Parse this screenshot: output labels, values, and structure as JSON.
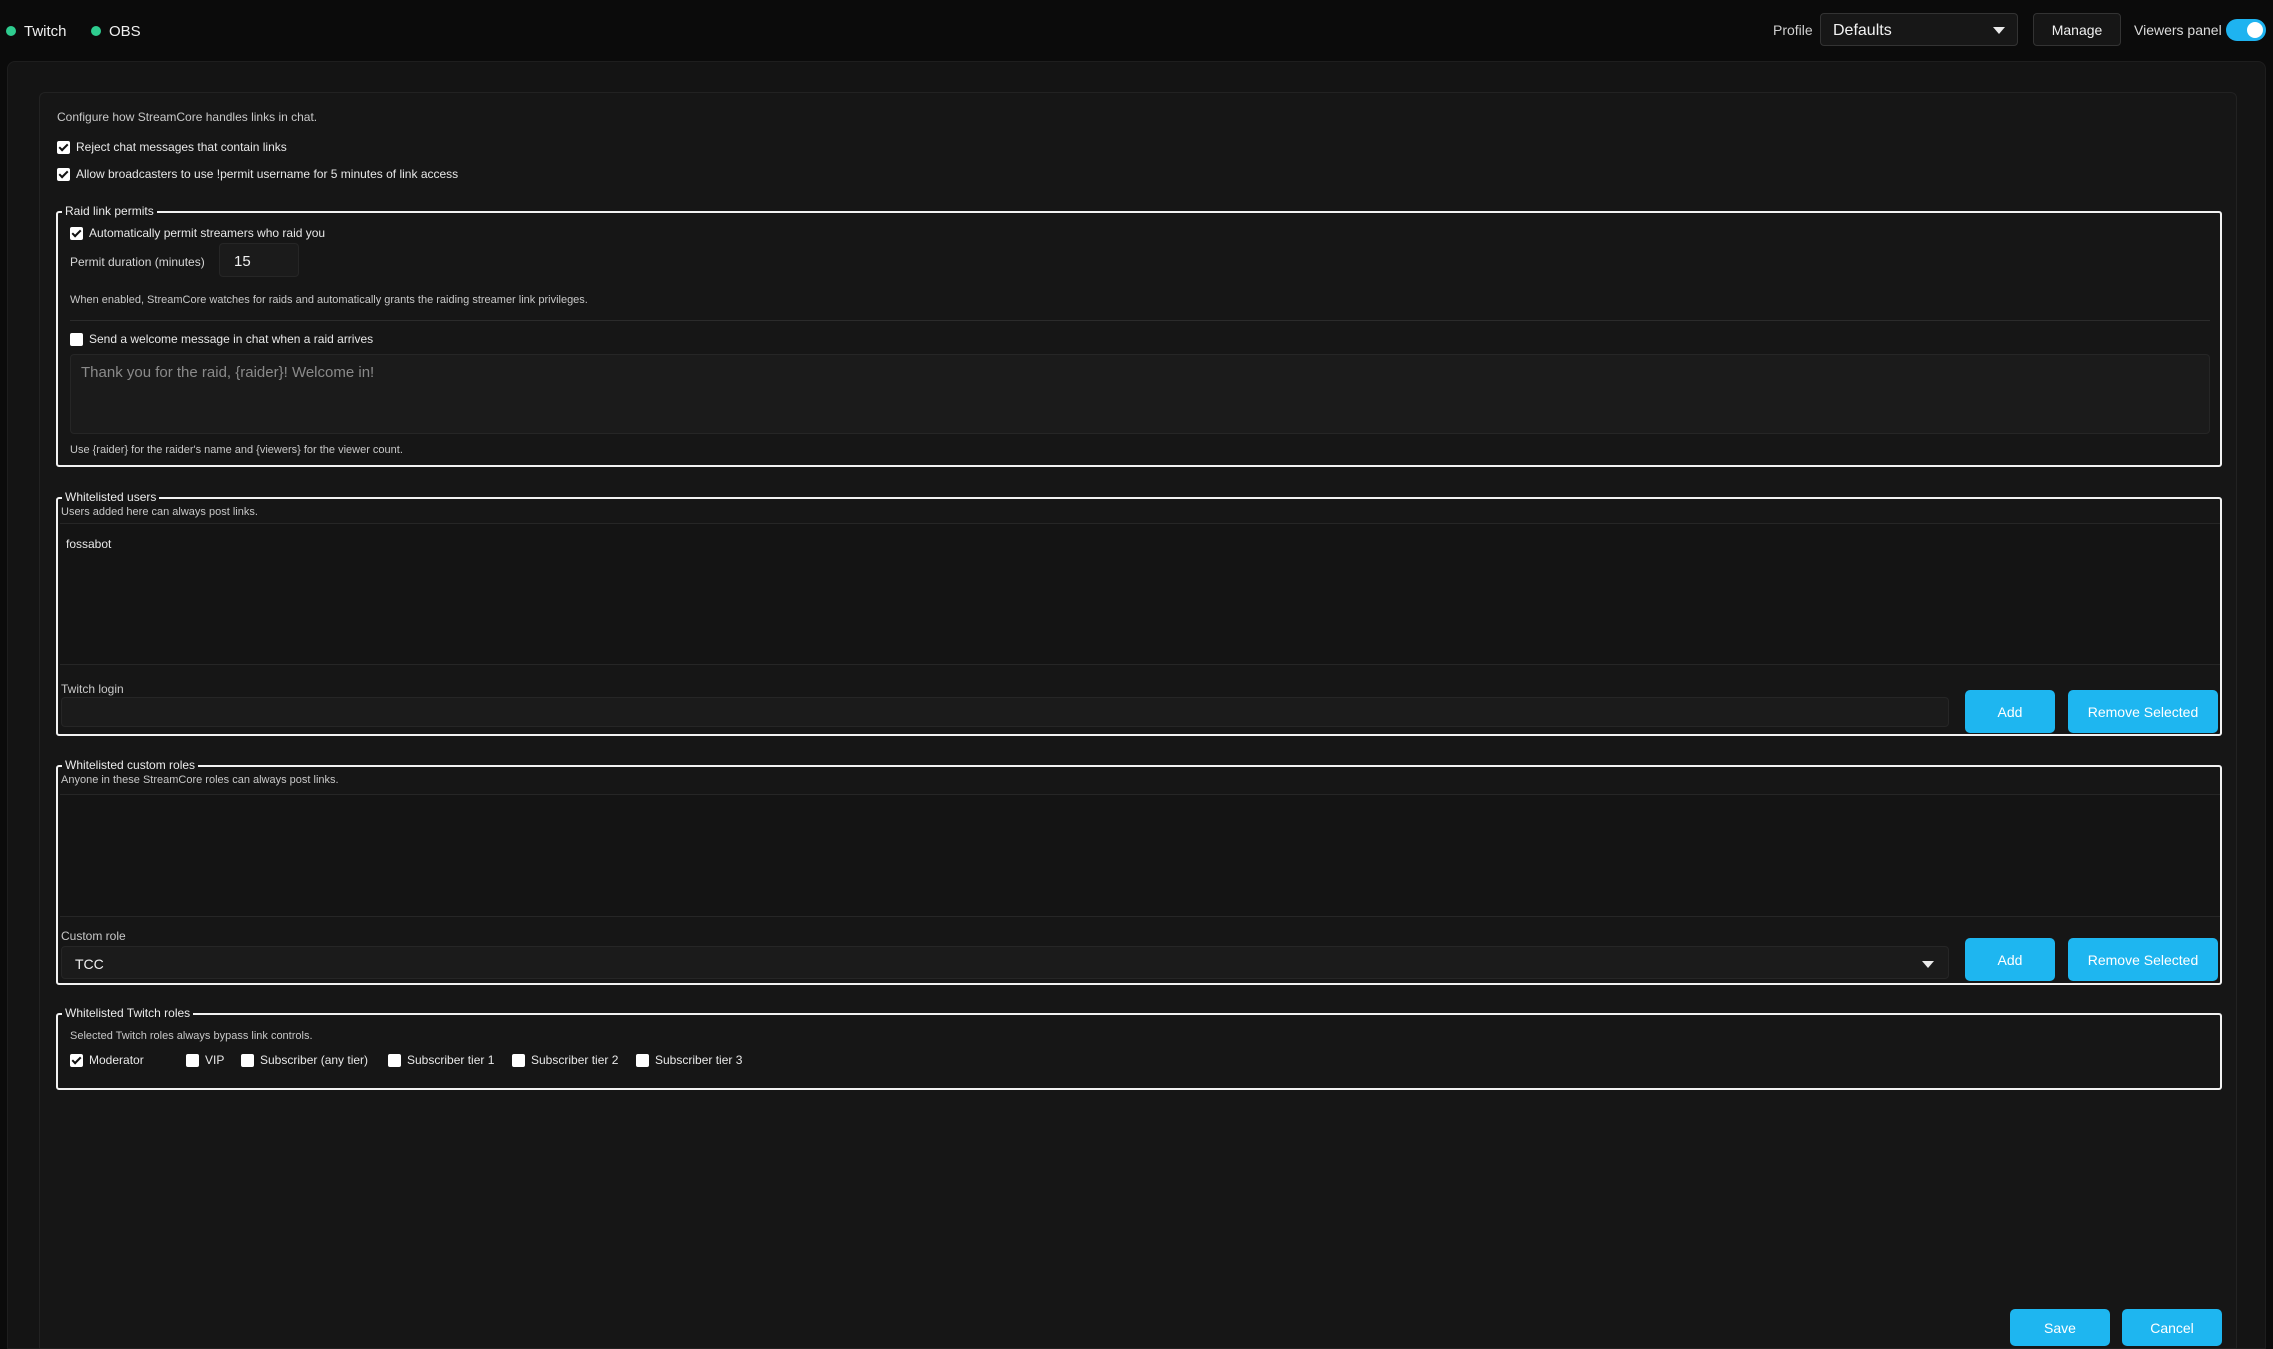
{
  "topbar": {
    "connections": [
      {
        "label": "Twitch",
        "status_color": "#2ecc8f"
      },
      {
        "label": "OBS",
        "status_color": "#2ecc8f"
      }
    ],
    "profile_label": "Profile",
    "profile_value": "Defaults",
    "manage_label": "Manage",
    "viewers_panel_label": "Viewers panel",
    "viewers_panel_on": true
  },
  "links": {
    "intro": "Configure how StreamCore handles links in chat.",
    "reject_links": {
      "label": "Reject chat messages that contain links",
      "checked": true
    },
    "allow_permit": {
      "label": "Allow broadcasters to use !permit username for 5 minutes of link access",
      "checked": true
    }
  },
  "raid": {
    "legend": "Raid link permits",
    "auto_permit": {
      "label": "Automatically permit streamers who raid you",
      "checked": true
    },
    "duration_label": "Permit duration (minutes)",
    "duration_value": "15",
    "auto_permit_hint": "When enabled, StreamCore watches for raids and automatically grants the raiding streamer link privileges.",
    "welcome": {
      "label": "Send a welcome message in chat when a raid arrives",
      "checked": false
    },
    "welcome_placeholder": "Thank you for the raid, {raider}! Welcome in!",
    "welcome_hint": "Use {raider} for the raider's name and {viewers} for the viewer count."
  },
  "users": {
    "legend": "Whitelisted users",
    "hint": "Users added here can always post links.",
    "items": [
      "fossabot"
    ],
    "login_label": "Twitch login",
    "add_label": "Add",
    "remove_label": "Remove Selected"
  },
  "custom_roles": {
    "legend": "Whitelisted custom roles",
    "hint": "Anyone in these StreamCore roles can always post links.",
    "role_label": "Custom role",
    "role_value": "TCC",
    "add_label": "Add",
    "remove_label": "Remove Selected"
  },
  "twitch_roles": {
    "legend": "Whitelisted Twitch roles",
    "hint": "Selected Twitch roles always bypass link controls.",
    "roles": [
      {
        "label": "Moderator",
        "checked": true
      },
      {
        "label": "VIP",
        "checked": false
      },
      {
        "label": "Subscriber (any tier)",
        "checked": false
      },
      {
        "label": "Subscriber tier 1",
        "checked": false
      },
      {
        "label": "Subscriber tier 2",
        "checked": false
      },
      {
        "label": "Subscriber tier 3",
        "checked": false
      }
    ]
  },
  "footer": {
    "save_label": "Save",
    "cancel_label": "Cancel"
  },
  "colors": {
    "accent": "#1eb6f0",
    "status_online": "#2ecc8f",
    "background": "#0b0b0b",
    "panel": "#161616"
  }
}
